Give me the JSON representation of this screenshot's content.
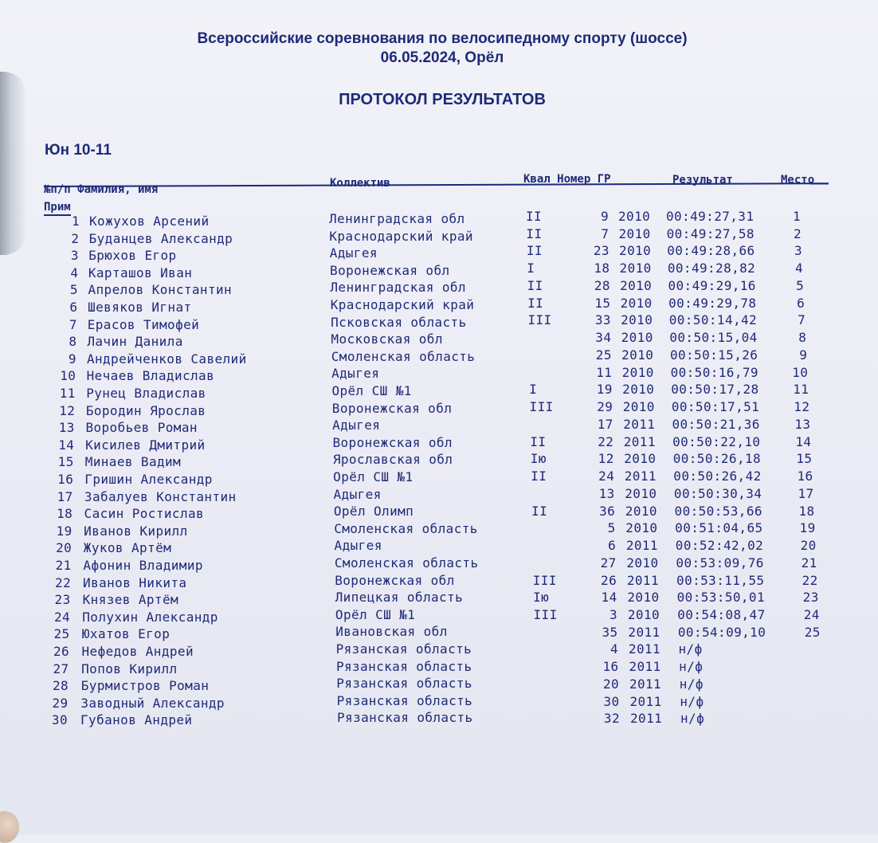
{
  "header": {
    "title_line1": "Всероссийские соревнования по велосипедному спорту (шоссе)",
    "title_line2": "06.05.2024, Орёл",
    "protocol_title": "ПРОТОКОЛ РЕЗУЛЬТАТОВ",
    "group": "Юн 10-11"
  },
  "columns": {
    "num_name": "№п/п Фамилия, имя",
    "team": "Коллектив",
    "kval_num_year": "Квал Номер ГР",
    "result": "Результат",
    "place": "Место"
  },
  "prim_label": "Прим",
  "rows": [
    {
      "num": "1",
      "name": "Кожухов Арсений",
      "team": "Ленинградская обл",
      "kval": "II",
      "bib": "9",
      "year": "2010",
      "result": "00:49:27,31",
      "place": "1"
    },
    {
      "num": "2",
      "name": "Буданцев Александр",
      "team": "Краснодарский край",
      "kval": "II",
      "bib": "7",
      "year": "2010",
      "result": "00:49:27,58",
      "place": "2"
    },
    {
      "num": "3",
      "name": "Брюхов Егор",
      "team": "Адыгея",
      "kval": "II",
      "bib": "23",
      "year": "2010",
      "result": "00:49:28,66",
      "place": "3"
    },
    {
      "num": "4",
      "name": "Карташов Иван",
      "team": "Воронежская обл",
      "kval": "I",
      "bib": "18",
      "year": "2010",
      "result": "00:49:28,82",
      "place": "4"
    },
    {
      "num": "5",
      "name": "Апрелов Константин",
      "team": "Ленинградская обл",
      "kval": "II",
      "bib": "28",
      "year": "2010",
      "result": "00:49:29,16",
      "place": "5"
    },
    {
      "num": "6",
      "name": "Шевяков Игнат",
      "team": "Краснодарский край",
      "kval": "II",
      "bib": "15",
      "year": "2010",
      "result": "00:49:29,78",
      "place": "6"
    },
    {
      "num": "7",
      "name": "Ерасов Тимофей",
      "team": "Псковская область",
      "kval": "III",
      "bib": "33",
      "year": "2010",
      "result": "00:50:14,42",
      "place": "7"
    },
    {
      "num": "8",
      "name": "Лачин Данила",
      "team": "Московская обл",
      "kval": "",
      "bib": "34",
      "year": "2010",
      "result": "00:50:15,04",
      "place": "8"
    },
    {
      "num": "9",
      "name": "Андрейченков Савелий",
      "team": "Смоленская область",
      "kval": "",
      "bib": "25",
      "year": "2010",
      "result": "00:50:15,26",
      "place": "9"
    },
    {
      "num": "10",
      "name": "Нечаев Владислав",
      "team": "Адыгея",
      "kval": "",
      "bib": "11",
      "year": "2010",
      "result": "00:50:16,79",
      "place": "10"
    },
    {
      "num": "11",
      "name": "Рунец Владислав",
      "team": "Орёл СШ №1",
      "kval": "I",
      "bib": "19",
      "year": "2010",
      "result": "00:50:17,28",
      "place": "11"
    },
    {
      "num": "12",
      "name": "Бородин Ярослав",
      "team": "Воронежская обл",
      "kval": "III",
      "bib": "29",
      "year": "2010",
      "result": "00:50:17,51",
      "place": "12"
    },
    {
      "num": "13",
      "name": "Воробьев Роман",
      "team": "Адыгея",
      "kval": "",
      "bib": "17",
      "year": "2011",
      "result": "00:50:21,36",
      "place": "13"
    },
    {
      "num": "14",
      "name": "Кисилев Дмитрий",
      "team": "Воронежская обл",
      "kval": "II",
      "bib": "22",
      "year": "2011",
      "result": "00:50:22,10",
      "place": "14"
    },
    {
      "num": "15",
      "name": "Минаев Вадим",
      "team": "Ярославская обл",
      "kval": "Iю",
      "bib": "12",
      "year": "2010",
      "result": "00:50:26,18",
      "place": "15"
    },
    {
      "num": "16",
      "name": "Гришин Александр",
      "team": "Орёл СШ №1",
      "kval": "II",
      "bib": "24",
      "year": "2011",
      "result": "00:50:26,42",
      "place": "16"
    },
    {
      "num": "17",
      "name": "Забалуев Константин",
      "team": "Адыгея",
      "kval": "",
      "bib": "13",
      "year": "2010",
      "result": "00:50:30,34",
      "place": "17"
    },
    {
      "num": "18",
      "name": "Сасин Ростислав",
      "team": "Орёл Олимп",
      "kval": "II",
      "bib": "36",
      "year": "2010",
      "result": "00:50:53,66",
      "place": "18"
    },
    {
      "num": "19",
      "name": "Иванов Кирилл",
      "team": "Смоленская область",
      "kval": "",
      "bib": "5",
      "year": "2010",
      "result": "00:51:04,65",
      "place": "19"
    },
    {
      "num": "20",
      "name": "Жуков Артём",
      "team": "Адыгея",
      "kval": "",
      "bib": "6",
      "year": "2011",
      "result": "00:52:42,02",
      "place": "20"
    },
    {
      "num": "21",
      "name": "Афонин Владимир",
      "team": "Смоленская область",
      "kval": "",
      "bib": "27",
      "year": "2010",
      "result": "00:53:09,76",
      "place": "21"
    },
    {
      "num": "22",
      "name": "Иванов Никита",
      "team": "Воронежская обл",
      "kval": "III",
      "bib": "26",
      "year": "2011",
      "result": "00:53:11,55",
      "place": "22"
    },
    {
      "num": "23",
      "name": "Князев Артём",
      "team": "Липецкая область",
      "kval": "Iю",
      "bib": "14",
      "year": "2010",
      "result": "00:53:50,01",
      "place": "23"
    },
    {
      "num": "24",
      "name": "Полухин Александр",
      "team": "Орёл СШ №1",
      "kval": "III",
      "bib": "3",
      "year": "2010",
      "result": "00:54:08,47",
      "place": "24"
    },
    {
      "num": "25",
      "name": "Юхатов Егор",
      "team": "Ивановская обл",
      "kval": "",
      "bib": "35",
      "year": "2011",
      "result": "00:54:09,10",
      "place": "25"
    },
    {
      "num": "26",
      "name": "Нефедов Андрей",
      "team": "Рязанская область",
      "kval": "",
      "bib": "4",
      "year": "2011",
      "result": "н/ф",
      "place": ""
    },
    {
      "num": "27",
      "name": "Попов Кирилл",
      "team": "Рязанская область",
      "kval": "",
      "bib": "16",
      "year": "2011",
      "result": "н/ф",
      "place": ""
    },
    {
      "num": "28",
      "name": "Бурмистров Роман",
      "team": "Рязанская область",
      "kval": "",
      "bib": "20",
      "year": "2011",
      "result": "н/ф",
      "place": ""
    },
    {
      "num": "29",
      "name": "Заводный Александр",
      "team": "Рязанская область",
      "kval": "",
      "bib": "30",
      "year": "2011",
      "result": "н/ф",
      "place": ""
    },
    {
      "num": "30",
      "name": "Губанов Андрей",
      "team": "Рязанская область",
      "kval": "",
      "bib": "32",
      "year": "2011",
      "result": "н/ф",
      "place": ""
    }
  ]
}
